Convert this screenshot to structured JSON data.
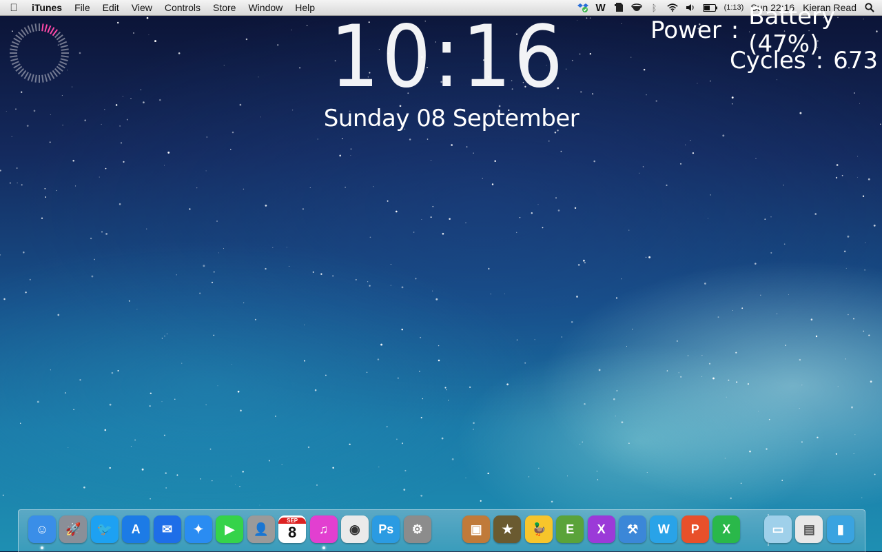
{
  "menubar": {
    "app_name": "iTunes",
    "menus": [
      "File",
      "Edit",
      "View",
      "Controls",
      "Store",
      "Window",
      "Help"
    ],
    "battery_time": "(1:13)",
    "clock": "Sun 22:16",
    "user": "Kieran Read"
  },
  "desktop_widgets": {
    "clock_hours": "10",
    "clock_minutes": "16",
    "date": "Sunday 08 September",
    "power_label": "Power",
    "power_value": "Battery (47%)",
    "cycles_label": "Cycles",
    "cycles_value": "673",
    "colon": ":"
  },
  "dock": {
    "calendar_day": "8",
    "calendar_month": "SEP",
    "apps_left": [
      {
        "name": "finder-icon",
        "color": "#3a8ee8"
      },
      {
        "name": "launchpad-icon",
        "color": "#8a8f98"
      },
      {
        "name": "twitter-icon",
        "color": "#1da1f2"
      },
      {
        "name": "app-store-icon",
        "color": "#1c7be6"
      },
      {
        "name": "mail-icon",
        "color": "#1e6ee8"
      },
      {
        "name": "safari-icon",
        "color": "#2a8cf2"
      },
      {
        "name": "facetime-icon",
        "color": "#35d34a"
      },
      {
        "name": "contacts-icon",
        "color": "#9a9a9a"
      },
      {
        "name": "calendar-icon",
        "color": "#ffffff"
      },
      {
        "name": "itunes-icon",
        "color": "#e23fd0"
      },
      {
        "name": "screenshot-icon",
        "color": "#eaeaea"
      },
      {
        "name": "photoshop-icon",
        "color": "#2b9be2"
      },
      {
        "name": "system-preferences-icon",
        "color": "#8c8c8c"
      }
    ],
    "apps_mid": [
      {
        "name": "iphoto-icon",
        "color": "#c07a3a"
      },
      {
        "name": "imovie-icon",
        "color": "#6a5a30"
      },
      {
        "name": "cyberduck-icon",
        "color": "#f7c52b"
      },
      {
        "name": "evernote-icon",
        "color": "#5aa33a"
      },
      {
        "name": "xmind-icon",
        "color": "#9b3ad8"
      },
      {
        "name": "xcode-icon",
        "color": "#3b87d8"
      },
      {
        "name": "word-icon",
        "color": "#29a3e8"
      },
      {
        "name": "powerpoint-icon",
        "color": "#e8502a"
      },
      {
        "name": "excel-icon",
        "color": "#2ab84a"
      }
    ],
    "apps_right": [
      {
        "name": "applications-folder-icon",
        "color": "#9fd0ea"
      },
      {
        "name": "document-stack-icon",
        "color": "#e8e8e8"
      },
      {
        "name": "downloads-stack-icon",
        "color": "#3aa3e0"
      }
    ]
  }
}
